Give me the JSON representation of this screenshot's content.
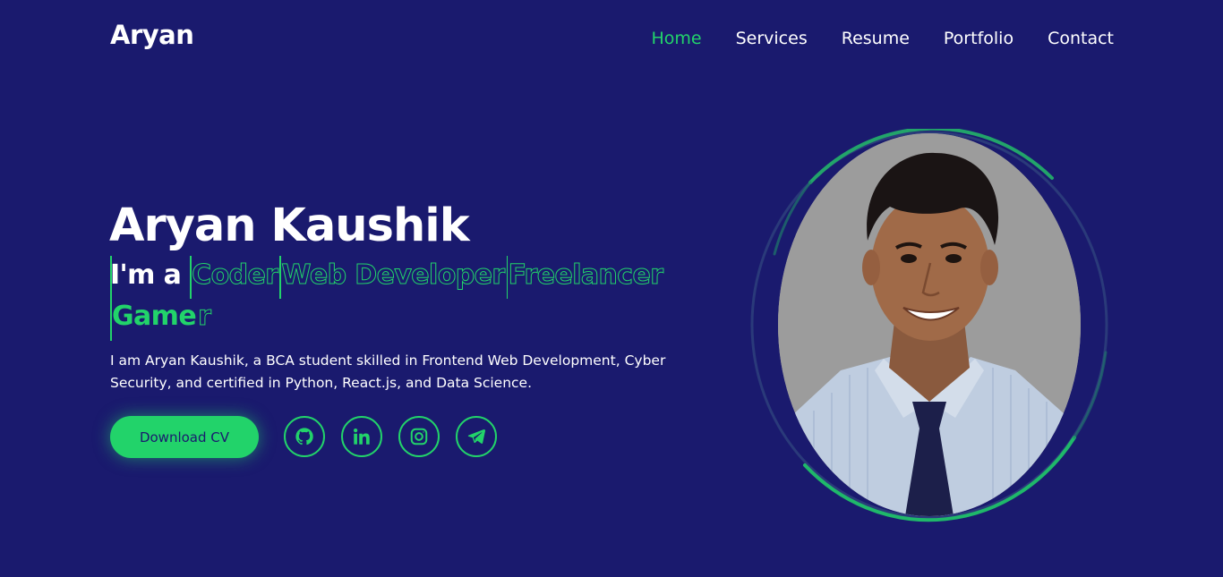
{
  "header": {
    "logo": "Aryan",
    "nav": [
      "Home",
      "Services",
      "Resume",
      "Portfolio",
      "Contact"
    ],
    "active_nav": "Home"
  },
  "hero": {
    "name": "Aryan Kaushik",
    "prefix": "I'm a",
    "roles": [
      "Coder",
      "Web Developer",
      "Freelancer"
    ],
    "typing_role_filled": "Game",
    "typing_role_rest": "r",
    "intro": "I am Aryan Kaushik, a BCA student skilled in Frontend Web Development, Cyber Security, and certified in Python, React.js, and Data Science.",
    "cta_label": "Download CV"
  },
  "socials": [
    {
      "icon": "github-icon"
    },
    {
      "icon": "linkedin-icon"
    },
    {
      "icon": "instagram-icon"
    },
    {
      "icon": "telegram-icon"
    }
  ],
  "colors": {
    "background": "#1a1a6e",
    "accent": "#22d36a",
    "text": "#ffffff"
  }
}
